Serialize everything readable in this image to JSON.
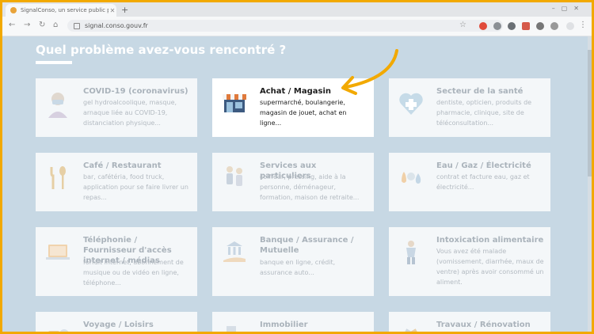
{
  "browser": {
    "tab_title": "SignalConso, un service public p...",
    "url": "signal.conso.gouv.fr"
  },
  "page": {
    "heading": "Quel problème avez-vous rencontré ?",
    "accent_color": "#f2a900",
    "cards": [
      {
        "title": "COVID-19 (coronavirus)",
        "desc": "gel hydroalcoolique, masque, arnaque liée au COVID-19, distanciation physique...",
        "icon": "person-mask-icon"
      },
      {
        "title": "Achat / Magasin",
        "desc": "supermarché, boulangerie, magasin de jouet, achat en ligne...",
        "icon": "store-icon"
      },
      {
        "title": "Secteur de la santé",
        "desc": "dentiste, opticien, produits de pharmacie, clinique, site de téléconsultation...",
        "icon": "health-heart-icon"
      },
      {
        "title": "Café / Restaurant",
        "desc": "bar, cafétéria, food truck, application pour se faire livrer un repas...",
        "icon": "fork-spoon-icon"
      },
      {
        "title": "Services aux particuliers",
        "desc": "coiffeur, pressing, aide à la personne, déménageur, formation, maison de retraite...",
        "icon": "people-icon"
      },
      {
        "title": "Eau / Gaz / Électricité",
        "desc": "contrat et facture eau, gaz et électricité...",
        "icon": "utilities-icon"
      },
      {
        "title": "Téléphonie / Fournisseur d'accès internet / médias",
        "desc": "forfait internet, abonnement de musique ou de vidéo en ligne, téléphone...",
        "icon": "laptop-icon"
      },
      {
        "title": "Banque / Assurance / Mutuelle",
        "desc": "banque en ligne, crédit, assurance auto...",
        "icon": "bank-hand-icon"
      },
      {
        "title": "Intoxication alimentaire",
        "desc": "Vous avez été malade (vomissement, diarrhée, maux de ventre) après avoir consommé un aliment.",
        "icon": "sick-person-icon"
      },
      {
        "title": "Voyage / Loisirs",
        "desc": "",
        "icon": "travel-icon"
      },
      {
        "title": "Immobilier",
        "desc": "",
        "icon": "building-icon"
      },
      {
        "title": "Travaux / Rénovation",
        "desc": "",
        "icon": "tools-icon"
      }
    ]
  }
}
